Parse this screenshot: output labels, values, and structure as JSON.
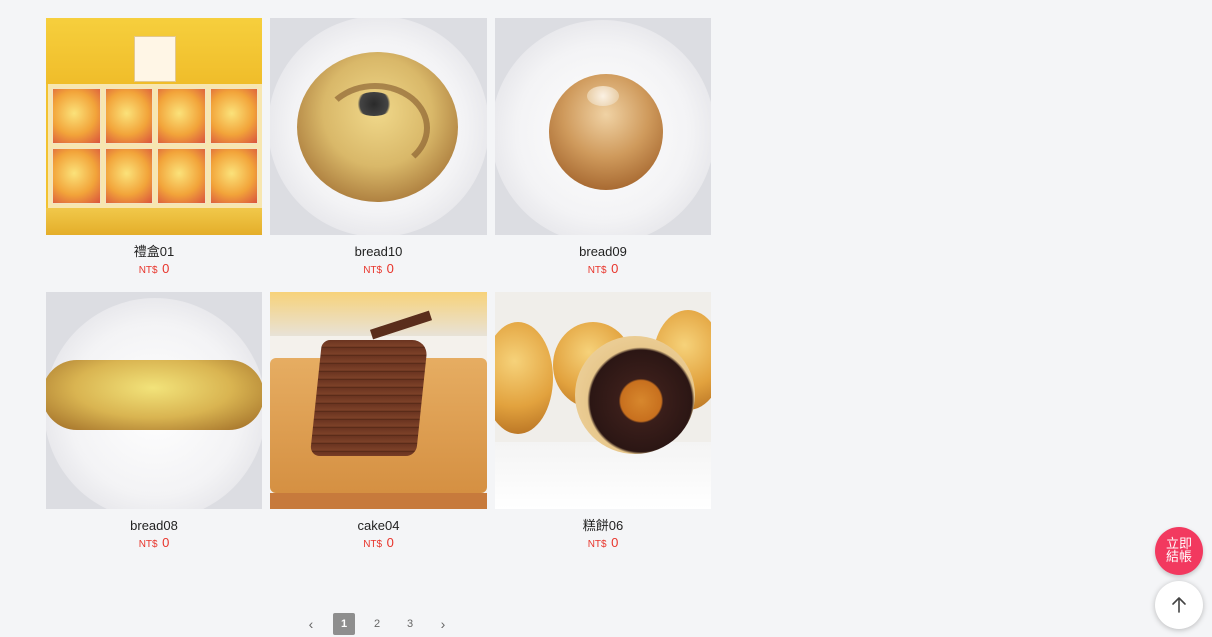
{
  "products": [
    {
      "name": "禮盒01",
      "currency": "NT$",
      "price": "0",
      "image": "gift-box-pastries"
    },
    {
      "name": "bread10",
      "currency": "NT$",
      "price": "0",
      "image": "round-bread"
    },
    {
      "name": "bread09",
      "currency": "NT$",
      "price": "0",
      "image": "bagel"
    },
    {
      "name": "bread08",
      "currency": "NT$",
      "price": "0",
      "image": "long-bread"
    },
    {
      "name": "cake04",
      "currency": "NT$",
      "price": "0",
      "image": "chocolate-cake-slice"
    },
    {
      "name": "糕餅06",
      "currency": "NT$",
      "price": "0",
      "image": "egg-yolk-pastry"
    }
  ],
  "pagination": {
    "prev": "‹",
    "pages": [
      "1",
      "2",
      "3"
    ],
    "current": "1",
    "next": "›"
  },
  "checkout": {
    "label": "立即結帳"
  },
  "colors": {
    "price": "#e8342b",
    "checkout_bg": "#f2395f",
    "page_active_bg": "#8e8e8e",
    "background": "#f4f5f7"
  },
  "icons": {
    "back_to_top": "arrow-up-icon",
    "prev": "chevron-left-icon",
    "next": "chevron-right-icon"
  }
}
